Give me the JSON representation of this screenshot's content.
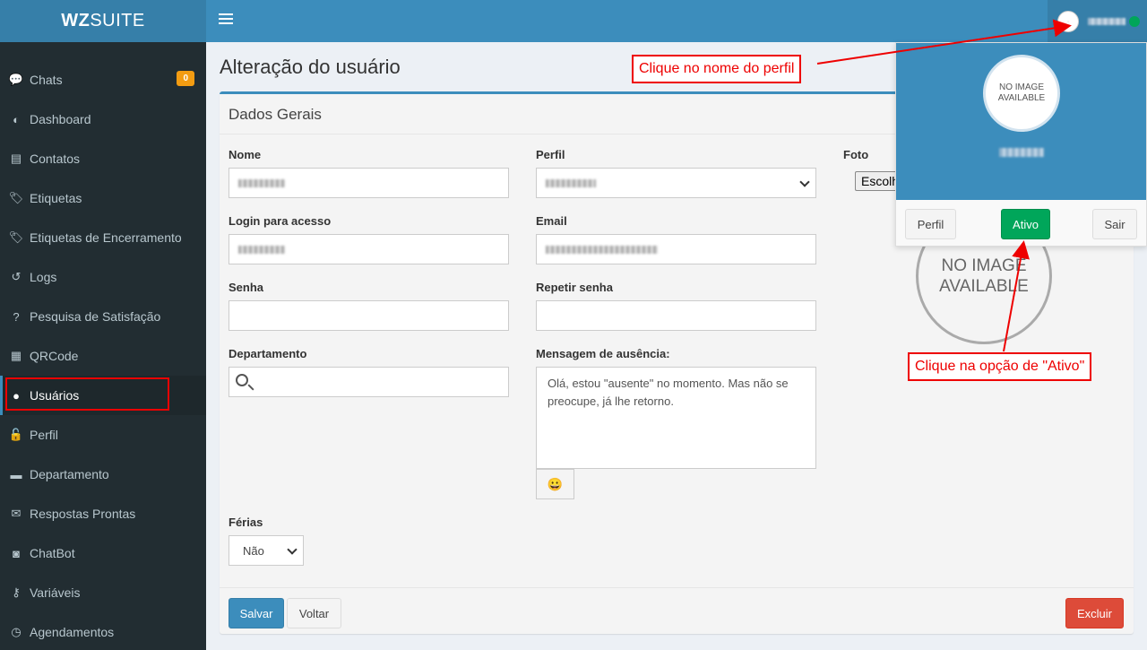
{
  "brand": {
    "bold": "WZ",
    "rest": "SUITE"
  },
  "sidebar": {
    "items": [
      {
        "label": "Chats",
        "icon": "chat-icon",
        "glyph": "💬",
        "badge": "0"
      },
      {
        "label": "Dashboard",
        "icon": "dashboard-icon",
        "glyph": "◐"
      },
      {
        "label": "Contatos",
        "icon": "contacts-icon",
        "glyph": "▤"
      },
      {
        "label": "Etiquetas",
        "icon": "tag-icon",
        "glyph": "🏷"
      },
      {
        "label": "Etiquetas de Encerramento",
        "icon": "tag-icon",
        "glyph": "🏷"
      },
      {
        "label": "Logs",
        "icon": "history-icon",
        "glyph": "↺"
      },
      {
        "label": "Pesquisa de Satisfação",
        "icon": "question-icon",
        "glyph": "?"
      },
      {
        "label": "QRCode",
        "icon": "qrcode-icon",
        "glyph": "▦"
      },
      {
        "label": "Usuários",
        "icon": "user-icon",
        "glyph": "●",
        "active": true
      },
      {
        "label": "Perfil",
        "icon": "unlock-icon",
        "glyph": "🔓"
      },
      {
        "label": "Departamento",
        "icon": "folder-icon",
        "glyph": "▬"
      },
      {
        "label": "Respostas Prontas",
        "icon": "envelope-icon",
        "glyph": "✉"
      },
      {
        "label": "ChatBot",
        "icon": "robot-icon",
        "glyph": "◙"
      },
      {
        "label": "Variáveis",
        "icon": "key-icon",
        "glyph": "⚷"
      },
      {
        "label": "Agendamentos",
        "icon": "clock-icon",
        "glyph": "◷"
      }
    ]
  },
  "page": {
    "title": "Alteração do usuário",
    "section_title": "Dados Gerais"
  },
  "form": {
    "nome_label": "Nome",
    "perfil_label": "Perfil",
    "foto_label": "Foto",
    "choose_file_label": "Escolher",
    "login_label": "Login para acesso",
    "email_label": "Email",
    "senha_label": "Senha",
    "repetir_senha_label": "Repetir senha",
    "departamento_label": "Departamento",
    "mensagem_label": "Mensagem de ausência:",
    "mensagem_value": "Olá, estou \"ausente\" no momento. Mas não se preocupe, já lhe retorno.",
    "ferias_label": "Férias",
    "ferias_value": "Não",
    "photo_placeholder": "NO IMAGE AVAILABLE"
  },
  "buttons": {
    "save": "Salvar",
    "back": "Voltar",
    "delete": "Excluir",
    "emoji": "😀"
  },
  "user_dropdown": {
    "avatar_placeholder": "NO IMAGE AVAILABLE",
    "profile_button": "Perfil",
    "status_button": "Ativo",
    "logout_button": "Sair"
  },
  "annotations": {
    "profile_name_hint": "Clique no nome do perfil",
    "active_option_hint": "Clique na opção de \"Ativo\""
  },
  "colors": {
    "brand_blue": "#3c8dbc",
    "sidebar_bg": "#222d32",
    "success_green": "#00a65a",
    "danger_red": "#dd4b39",
    "badge_orange": "#f39c12",
    "annotation_red": "#ee0000"
  }
}
